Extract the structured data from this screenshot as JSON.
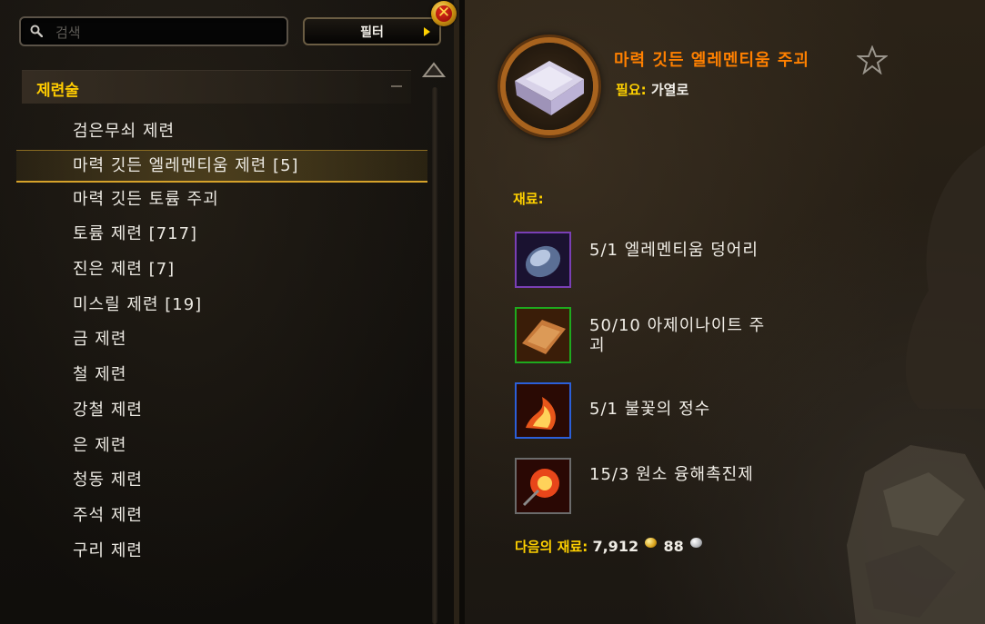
{
  "left_panel": {
    "search": {
      "placeholder": "검색"
    },
    "filter_label": "필터",
    "close_symbol": "✕",
    "category": {
      "label": "제련술",
      "collapse_symbol": "–"
    },
    "recipes": [
      {
        "label": "검은무쇠 제련",
        "selected": false
      },
      {
        "label": "마력 깃든 엘레멘티움 제련 [5]",
        "selected": true
      },
      {
        "label": "마력 깃든 토륨 주괴",
        "selected": false
      },
      {
        "label": "토륨 제련 [717]",
        "selected": false
      },
      {
        "label": "진은 제련 [7]",
        "selected": false
      },
      {
        "label": "미스릴 제련 [19]",
        "selected": false
      },
      {
        "label": "금 제련",
        "selected": false
      },
      {
        "label": "철 제련",
        "selected": false
      },
      {
        "label": "강철 제련",
        "selected": false
      },
      {
        "label": "은 제련",
        "selected": false
      },
      {
        "label": "청동 제련",
        "selected": false
      },
      {
        "label": "주석 제련",
        "selected": false
      },
      {
        "label": "구리 제련",
        "selected": false
      }
    ]
  },
  "detail": {
    "item_name": "마력 깃든 엘레멘티움 주괴",
    "item_icon": "ingot-icon",
    "item_quality_color": "#ff8000",
    "requires_label": "필요:",
    "requires_value": "가열로",
    "reagents_label": "재료:",
    "reagents": [
      {
        "text": "5/1 엘레멘티움 덩어리",
        "icon": "elementium-ore-icon",
        "border": "#7a3fb5"
      },
      {
        "text": "50/10 아제이나이트 주괴",
        "icon": "azerite-ingot-icon",
        "border": "#1eaa1e"
      },
      {
        "text": "5/1 불꽃의 정수",
        "icon": "essence-of-fire-icon",
        "border": "#2b5fd9"
      },
      {
        "text": "15/3 원소 융해촉진제",
        "icon": "elemental-flux-icon",
        "border": "#6b6b6b"
      }
    ],
    "cost_label": "다음의 재료:",
    "cost_gold": "7,912",
    "cost_silver": "88"
  },
  "colors": {
    "accent_yellow": "#ffd100",
    "selection_gold": "#d6a22a"
  }
}
